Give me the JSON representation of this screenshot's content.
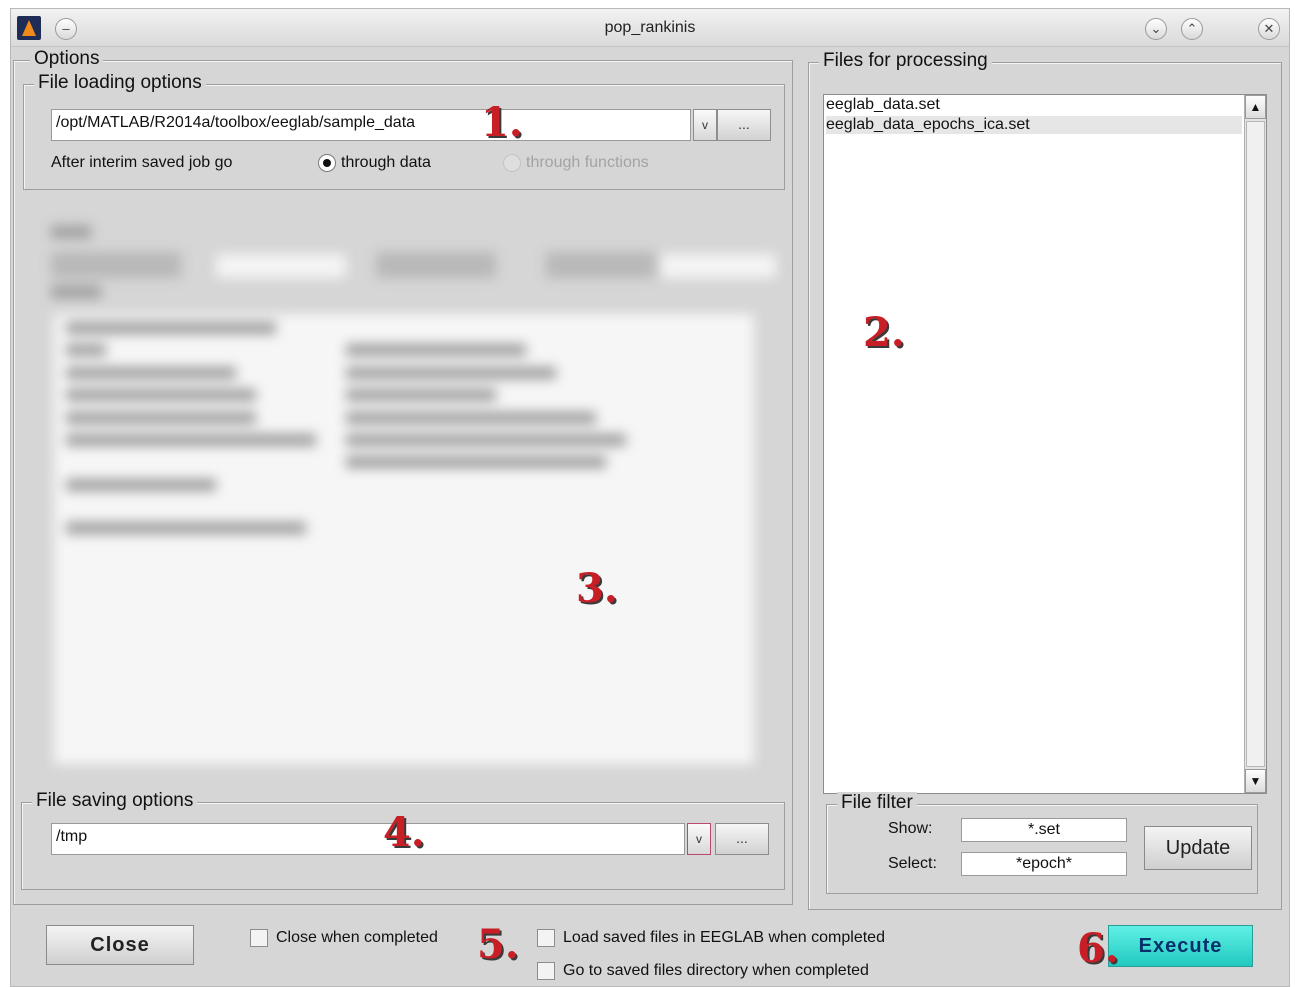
{
  "window": {
    "title": "pop_rankinis"
  },
  "titlebar_icons": {
    "app": "matlab-logo-icon",
    "menu": "window-menu-icon",
    "minimize": "chevron-down-icon",
    "maximize": "chevron-up-icon",
    "close": "close-icon"
  },
  "options_panel": {
    "title": "Options",
    "file_loading": {
      "title": "File loading options",
      "path_value": "/opt/MATLAB/R2014a/toolbox/eeglab/sample_data",
      "dropdown_glyph": "v",
      "browse_label": "...",
      "interim_label": "After interim saved job go",
      "radio_through_data": "through data",
      "radio_through_functions": "through functions",
      "selected": "through data"
    },
    "file_saving": {
      "title": "File saving options",
      "path_value": "/tmp",
      "dropdown_glyph": "v",
      "browse_label": "..."
    }
  },
  "files_panel": {
    "title": "Files for processing",
    "files": [
      "eeglab_data.set",
      "eeglab_data_epochs_ica.set"
    ],
    "filter": {
      "title": "File filter",
      "show_label": "Show:",
      "show_value": "*.set",
      "select_label": "Select:",
      "select_value": "*epoch*",
      "update_label": "Update"
    }
  },
  "bottom_bar": {
    "close_label": "Close",
    "close_when_completed": "Close when completed",
    "load_saved_files": "Load saved files in EEGLAB when completed",
    "goto_saved_dir": "Go to saved files directory when completed",
    "execute_label": "Execute"
  },
  "annotations": [
    "1.",
    "2.",
    "3.",
    "4.",
    "5.",
    "6."
  ],
  "colors": {
    "annotation": "#c81e26",
    "execute_button": "#2ed8ce",
    "window_bg": "#d6d6d6"
  }
}
